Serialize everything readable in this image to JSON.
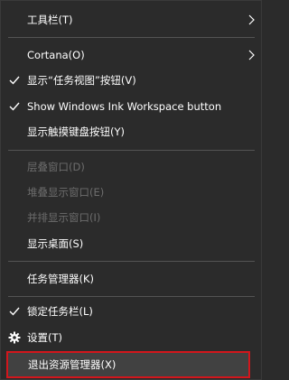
{
  "menu": {
    "toolbar": "工具栏(T)",
    "cortana": "Cortana(O)",
    "task_view": "显示“任务视图”按钮(V)",
    "ink_workspace": "Show Windows Ink Workspace button",
    "touch_keyboard": "显示触摸键盘按钮(Y)",
    "cascade": "层叠窗口(D)",
    "stacked": "堆叠显示窗口(E)",
    "side_by_side": "并排显示窗口(I)",
    "show_desktop": "显示桌面(S)",
    "task_manager": "任务管理器(K)",
    "lock_taskbar": "锁定任务栏(L)",
    "settings": "设置(T)",
    "exit_explorer": "退出资源管理器(X)"
  },
  "colors": {
    "background": "#2b2b2b",
    "text": "#ffffff",
    "disabled_text": "#6d6d6d",
    "separator": "#545454",
    "highlight_border": "#d2161c"
  },
  "icons": {
    "checkmark": "check-icon",
    "settings": "gear-icon",
    "submenu": "chevron-right-icon"
  }
}
